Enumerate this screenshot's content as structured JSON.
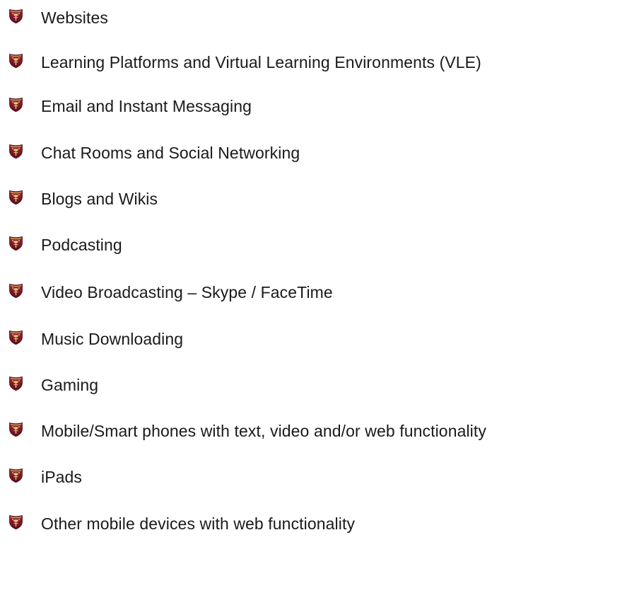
{
  "bullet_icon": "shield-crest-icon",
  "colors": {
    "shield_dark": "#6b1021",
    "shield_mid": "#8e1f2e",
    "shield_gold": "#d9b25a",
    "text": "#1a1a1a"
  },
  "items": [
    {
      "label": "Websites"
    },
    {
      "label": "Learning Platforms and Virtual Learning Environments (VLE)"
    },
    {
      "label": "Email and Instant Messaging"
    },
    {
      "label": "Chat Rooms and Social Networking"
    },
    {
      "label": "Blogs and Wikis"
    },
    {
      "label": "Podcasting"
    },
    {
      "label": "Video Broadcasting – Skype / FaceTime"
    },
    {
      "label": "Music Downloading"
    },
    {
      "label": "Gaming"
    },
    {
      "label": "Mobile/Smart phones with text, video and/or web functionality"
    },
    {
      "label": "iPads"
    },
    {
      "label": "Other mobile devices with web functionality"
    }
  ]
}
